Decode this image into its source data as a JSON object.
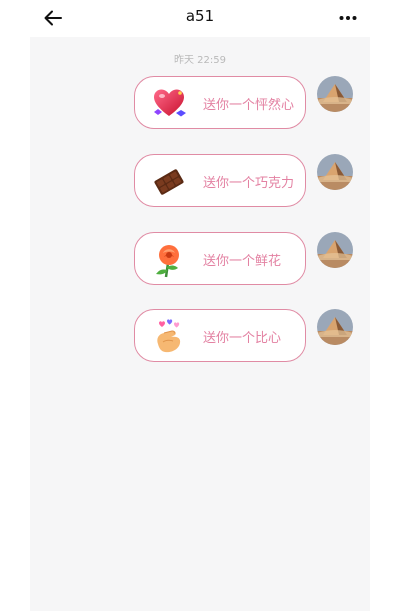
{
  "header": {
    "title": "a51",
    "back_icon": "arrow-left-icon",
    "more_icon": "more-dots-icon"
  },
  "chat": {
    "timestamp": "昨天 22:59",
    "messages": [
      {
        "text": "送你一个怦然心",
        "icon": "heart-gift-icon"
      },
      {
        "text": "送你一个巧克力",
        "icon": "chocolate-gift-icon"
      },
      {
        "text": "送你一个鲜花",
        "icon": "rose-gift-icon"
      },
      {
        "text": "送你一个比心",
        "icon": "finger-heart-gift-icon"
      }
    ]
  },
  "colors": {
    "bubble_border": "#e08ba4",
    "gift_text": "#e381a2",
    "chat_background": "#f6f6f7"
  }
}
